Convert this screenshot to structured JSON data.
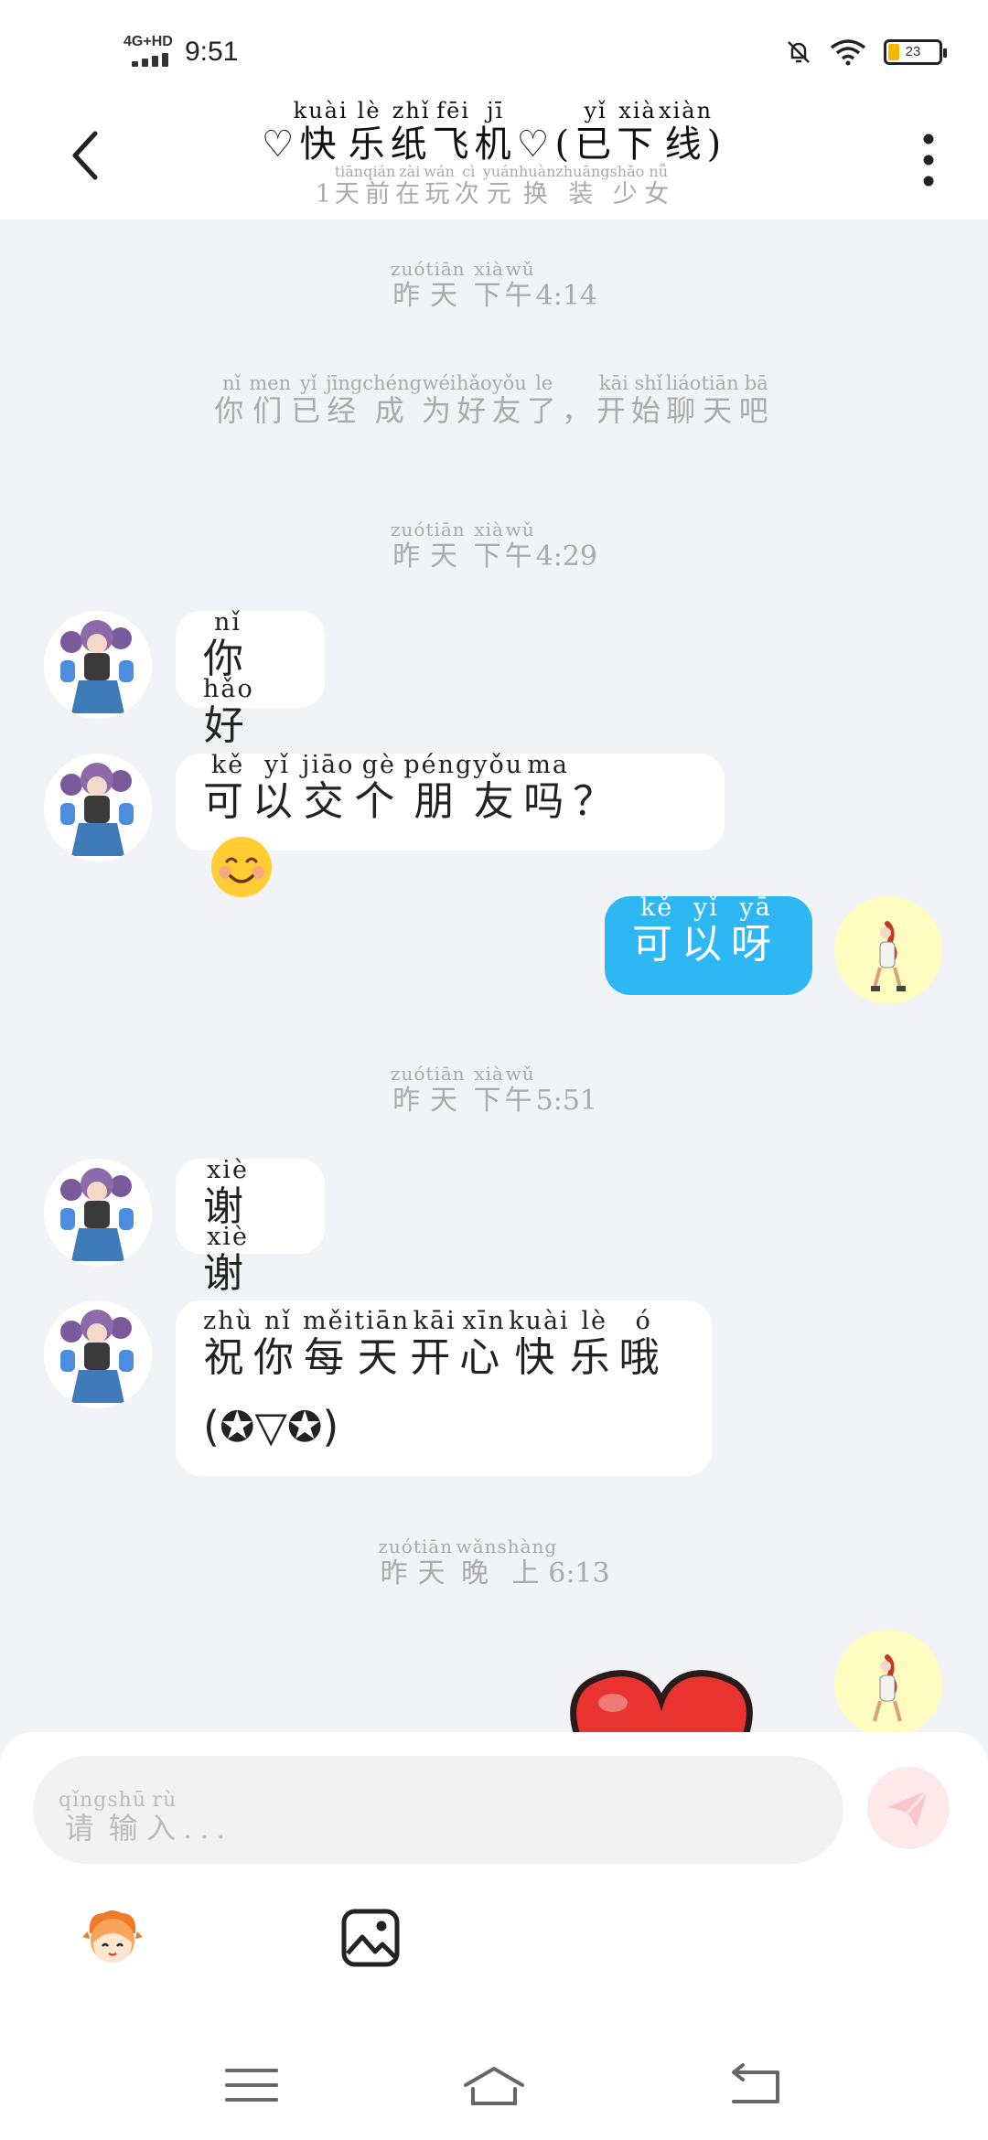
{
  "status_bar": {
    "network": "4G+HD",
    "time": "9:51",
    "battery": "23",
    "battery_level": 0.23,
    "icons": [
      "mute-bell-icon",
      "wifi-icon",
      "battery-icon"
    ]
  },
  "header": {
    "title": [
      {
        "t": "♡"
      },
      {
        "t": "快",
        "p": "kuài"
      },
      {
        "t": "乐",
        "p": "lè"
      },
      {
        "t": "纸",
        "p": "zhǐ"
      },
      {
        "t": "飞",
        "p": "fēi"
      },
      {
        "t": "机",
        "p": "jī"
      },
      {
        "t": "♡("
      },
      {
        "t": "已",
        "p": "yǐ"
      },
      {
        "t": "下",
        "p": "xià"
      },
      {
        "t": "线",
        "p": "xiàn"
      },
      {
        "t": ")"
      }
    ],
    "subtitle": [
      {
        "t": "1"
      },
      {
        "t": "天",
        "p": "tiān"
      },
      {
        "t": "前",
        "p": "qián"
      },
      {
        "t": "在",
        "p": "zài"
      },
      {
        "t": "玩",
        "p": "wán"
      },
      {
        "t": "次",
        "p": "cì"
      },
      {
        "t": "元",
        "p": "yuán"
      },
      {
        "t": "换",
        "p": "huàn"
      },
      {
        "t": "装",
        "p": "zhuāng"
      },
      {
        "t": "少",
        "p": "shǎo"
      },
      {
        "t": "女",
        "p": "nǚ"
      }
    ],
    "back_icon": "chevron-left-icon",
    "more_icon": "more-vertical-icon"
  },
  "messages": [
    {
      "kind": "timestamp",
      "id": "ts1",
      "segs": [
        {
          "t": "昨",
          "p": "zuó"
        },
        {
          "t": "天",
          "p": "tiān"
        },
        {
          "t": " "
        },
        {
          "t": "下",
          "p": "xià"
        },
        {
          "t": "午",
          "p": "wǔ"
        },
        {
          "t": "4:14",
          "num": true
        }
      ]
    },
    {
      "kind": "system",
      "id": "sys1",
      "segs": [
        {
          "t": "你",
          "p": "nǐ"
        },
        {
          "t": "们",
          "p": "men"
        },
        {
          "t": "已",
          "p": "yǐ"
        },
        {
          "t": "经",
          "p": "jīng"
        },
        {
          "t": "成",
          "p": "chéng"
        },
        {
          "t": "为",
          "p": "wéi"
        },
        {
          "t": "好",
          "p": "hǎo"
        },
        {
          "t": "友",
          "p": "yǒu"
        },
        {
          "t": "了",
          "p": "le"
        },
        {
          "t": "，"
        },
        {
          "t": "开",
          "p": "kāi"
        },
        {
          "t": "始",
          "p": "shǐ"
        },
        {
          "t": "聊",
          "p": "liáo"
        },
        {
          "t": "天",
          "p": "tiān"
        },
        {
          "t": "吧",
          "p": "bā"
        }
      ]
    },
    {
      "kind": "timestamp",
      "id": "ts2",
      "segs": [
        {
          "t": "昨",
          "p": "zuó"
        },
        {
          "t": "天",
          "p": "tiān"
        },
        {
          "t": " "
        },
        {
          "t": "下",
          "p": "xià"
        },
        {
          "t": "午",
          "p": "wǔ"
        },
        {
          "t": "4:29",
          "num": true
        }
      ]
    },
    {
      "kind": "in",
      "id": "m1",
      "segs": [
        {
          "t": "你",
          "p": "nǐ"
        },
        {
          "t": "好",
          "p": "hǎo"
        }
      ]
    },
    {
      "kind": "in",
      "id": "m2",
      "segs": [
        {
          "t": "可",
          "p": "kě"
        },
        {
          "t": "以",
          "p": "yǐ"
        },
        {
          "t": "交",
          "p": "jiāo"
        },
        {
          "t": "个",
          "p": "gè"
        },
        {
          "t": "朋",
          "p": "péng"
        },
        {
          "t": "友",
          "p": "yǒu"
        },
        {
          "t": "吗",
          "p": "ma"
        },
        {
          "t": "？"
        }
      ],
      "emoji": "smiling-face-emoji"
    },
    {
      "kind": "out",
      "id": "m3",
      "segs": [
        {
          "t": "可",
          "p": "kě"
        },
        {
          "t": "以",
          "p": "yǐ"
        },
        {
          "t": "呀",
          "p": "yā"
        }
      ]
    },
    {
      "kind": "timestamp",
      "id": "ts3",
      "segs": [
        {
          "t": "昨",
          "p": "zuó"
        },
        {
          "t": "天",
          "p": "tiān"
        },
        {
          "t": " "
        },
        {
          "t": "下",
          "p": "xià"
        },
        {
          "t": "午",
          "p": "wǔ"
        },
        {
          "t": "5:51",
          "num": true
        }
      ]
    },
    {
      "kind": "in",
      "id": "m4",
      "segs": [
        {
          "t": "谢",
          "p": "xiè"
        },
        {
          "t": "谢",
          "p": "xiè"
        }
      ]
    },
    {
      "kind": "in",
      "id": "m5",
      "segs": [
        {
          "t": "祝",
          "p": "zhù"
        },
        {
          "t": "你",
          "p": "nǐ"
        },
        {
          "t": "每",
          "p": "měi"
        },
        {
          "t": "天",
          "p": "tiān"
        },
        {
          "t": "开",
          "p": "kāi"
        },
        {
          "t": "心",
          "p": "xīn"
        },
        {
          "t": "快",
          "p": "kuài"
        },
        {
          "t": "乐",
          "p": "lè"
        },
        {
          "t": "哦",
          "p": "ó"
        }
      ],
      "line2": "(✪▽✪)"
    },
    {
      "kind": "timestamp",
      "id": "ts4",
      "segs": [
        {
          "t": "昨",
          "p": "zuó"
        },
        {
          "t": "天",
          "p": "tiān"
        },
        {
          "t": " "
        },
        {
          "t": "晚",
          "p": "wǎn"
        },
        {
          "t": "上",
          "p": "shàng"
        },
        {
          "t": "6:13",
          "num": true
        }
      ]
    },
    {
      "kind": "out-sticker",
      "id": "m6",
      "sticker": "heart-sticker"
    }
  ],
  "composer": {
    "placeholder": [
      {
        "t": "请",
        "p": "qǐng"
      },
      {
        "t": "输",
        "p": "shū"
      },
      {
        "t": "入",
        "p": "rù"
      },
      {
        "t": "..."
      }
    ],
    "send_icon": "send-icon",
    "tools": [
      "emoji-mascot-icon",
      "image-icon"
    ]
  },
  "nav_bar": {
    "buttons": [
      "menu-icon",
      "home-icon",
      "back-icon"
    ]
  }
}
